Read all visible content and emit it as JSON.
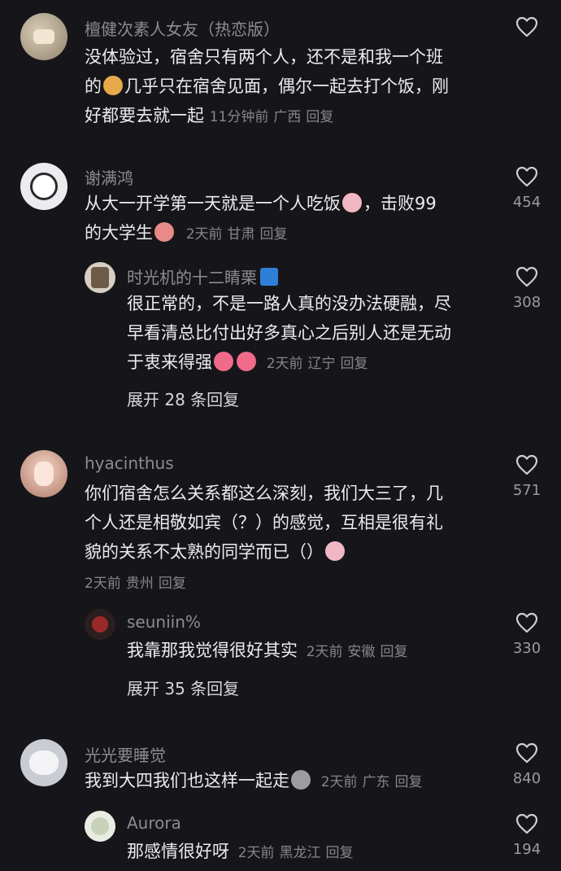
{
  "comments": [
    {
      "name": "檀健次素人女友（热恋版）",
      "text_a": "没体验过，宿舍只有两个人，还不是和我一个班",
      "text_b1": "的",
      "text_b2": "几乎只在宿舍见面，偶尔一起去打个饭，刚",
      "text_c": "好都要去就一起",
      "time": "11分钟前",
      "region": "广西",
      "reply_label": "回复",
      "likes": ""
    },
    {
      "name": "谢满鸿",
      "text_a1": "从大一开学第一天就是一个人吃饭",
      "text_a2": "，击败99",
      "text_b": "的大学生",
      "time": "2天前",
      "region": "甘肃",
      "reply_label": "回复",
      "likes": "454",
      "reply": {
        "name": "时光机的十二睛栗",
        "text_a": "很正常的，不是一路人真的没办法硬融，尽",
        "text_b": "早看清总比付出好多真心之后别人还是无动",
        "text_c": "于衷来得强",
        "time": "2天前",
        "region": "辽宁",
        "reply_label": "回复",
        "likes": "308"
      },
      "expand": "展开 28 条回复"
    },
    {
      "name": "hyacinthus",
      "text_a": "你们宿舍怎么关系都这么深刻，我们大三了，几",
      "text_b": "个人还是相敬如宾（？）的感觉，互相是很有礼",
      "text_c": "貌的关系不太熟的同学而已（）",
      "time": "2天前",
      "region": "贵州",
      "reply_label": "回复",
      "likes": "571",
      "reply": {
        "name": "seuniin%",
        "text": "我靠那我觉得很好其实",
        "time": "2天前",
        "region": "安徽",
        "reply_label": "回复",
        "likes": "330"
      },
      "expand": "展开 35 条回复"
    },
    {
      "name": "光光要睡觉",
      "text": "我到大四我们也这样一起走",
      "time": "2天前",
      "region": "广东",
      "reply_label": "回复",
      "likes": "840",
      "reply": {
        "name": "Aurora",
        "text": "那感情很好呀",
        "time": "2天前",
        "region": "黑龙江",
        "reply_label": "回复",
        "likes": "194"
      }
    }
  ],
  "icons": {
    "like": "heart-outline-icon",
    "emojis": [
      "smirk-emoji",
      "crying-emoji",
      "screaming-emoji",
      "pink-blob-emoji",
      "pink-blob-emoji",
      "crying-emoji",
      "sweating-gray-emoji",
      "v-badge-icon"
    ]
  },
  "colors": {
    "background": "#16161a",
    "text": "#ececee",
    "muted": "#85858c"
  }
}
